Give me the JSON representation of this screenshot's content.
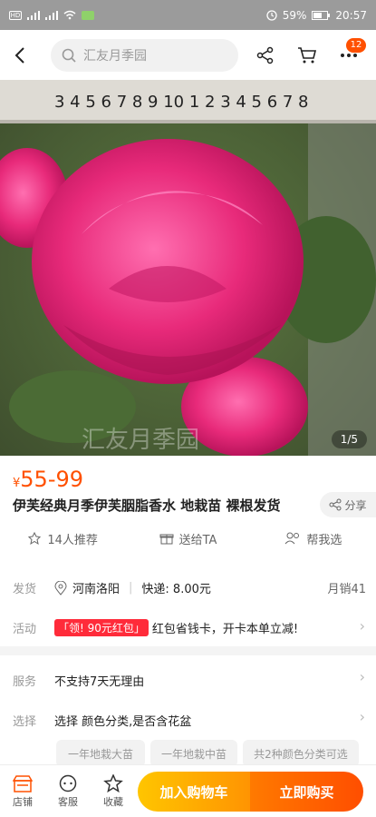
{
  "statusbar": {
    "time": "20:57",
    "battery": "59%",
    "left_icons": [
      "HD",
      "signal",
      "signal",
      "wifi",
      "app"
    ]
  },
  "topnav": {
    "search_placeholder": "汇友月季园",
    "cart_badge": "12"
  },
  "hero": {
    "indicator": "1/5",
    "watermark": "汇友月季园",
    "ruler": "3 4 5 6 7 8 9 10 1 2 3 4 5 6 7 8"
  },
  "product": {
    "currency": "¥",
    "price": "55-99",
    "title": "伊芙经典月季伊芙胭脂香水 地栽苗 裸根发货",
    "share": "分享",
    "recommend": "14人推荐",
    "gift": "送给TA",
    "help": "帮我选"
  },
  "shipping": {
    "label": "发货",
    "location": "河南洛阳",
    "express": "快递: 8.00元",
    "monthly": "月销41"
  },
  "promo": {
    "label": "活动",
    "tag": "「领! 90元红包」",
    "text": "红包省钱卡，开卡本单立减!"
  },
  "service": {
    "label": "服务",
    "text": "不支持7天无理由"
  },
  "choose": {
    "label": "选择",
    "text": "选择 颜色分类,是否含花盆",
    "chips": [
      "一年地栽大苗",
      "一年地栽中苗",
      "共2种颜色分类可选"
    ]
  },
  "bottom": {
    "store": "店铺",
    "service": "客服",
    "fav": "收藏",
    "cart": "加入购物车",
    "buy": "立即购买"
  },
  "colors": {
    "accent": "#ff5000",
    "cart": "#ffb000",
    "buy": "#ff5a00"
  }
}
